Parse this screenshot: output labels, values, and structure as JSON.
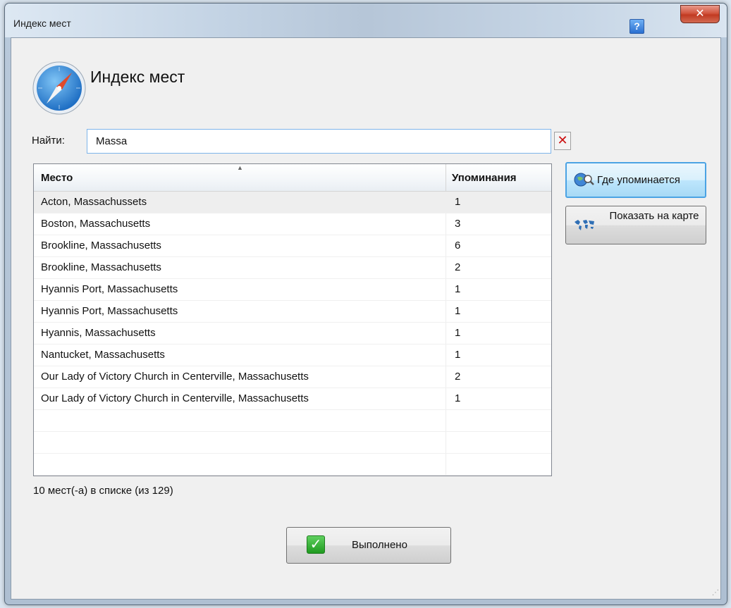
{
  "window": {
    "title": "Индекс мест",
    "help_label": "?",
    "close_label": "✕"
  },
  "header": {
    "title": "Индекс мест",
    "icon": "compass-icon"
  },
  "search": {
    "label": "Найти:",
    "value": "Massa",
    "clear_label": "✕"
  },
  "table": {
    "columns": [
      "Место",
      "Упоминания"
    ],
    "sort_indicator": "▲",
    "rows": [
      {
        "place": "Acton, Massachussets",
        "count": "1"
      },
      {
        "place": "Boston, Massachusetts",
        "count": "3"
      },
      {
        "place": "Brookline, Massachusetts",
        "count": "6"
      },
      {
        "place": "Brookline, Massachusetts",
        "count": "2"
      },
      {
        "place": "Hyannis Port, Massachusetts",
        "count": "1"
      },
      {
        "place": "Hyannis Port, Massachusetts",
        "count": "1"
      },
      {
        "place": "Hyannis, Massachusetts",
        "count": "1"
      },
      {
        "place": "Nantucket, Massachusetts",
        "count": "1"
      },
      {
        "place": "Our Lady of Victory Church in Centerville, Massachusetts",
        "count": "2"
      },
      {
        "place": "Our Lady of Victory Church in Centerville, Massachusetts",
        "count": "1"
      }
    ]
  },
  "actions": {
    "where_mentioned": "Где упоминается",
    "show_on_map": "Показать на карте"
  },
  "status": "10 мест(-а) в списке (из 129)",
  "footer": {
    "done_label": "Выполнено"
  }
}
